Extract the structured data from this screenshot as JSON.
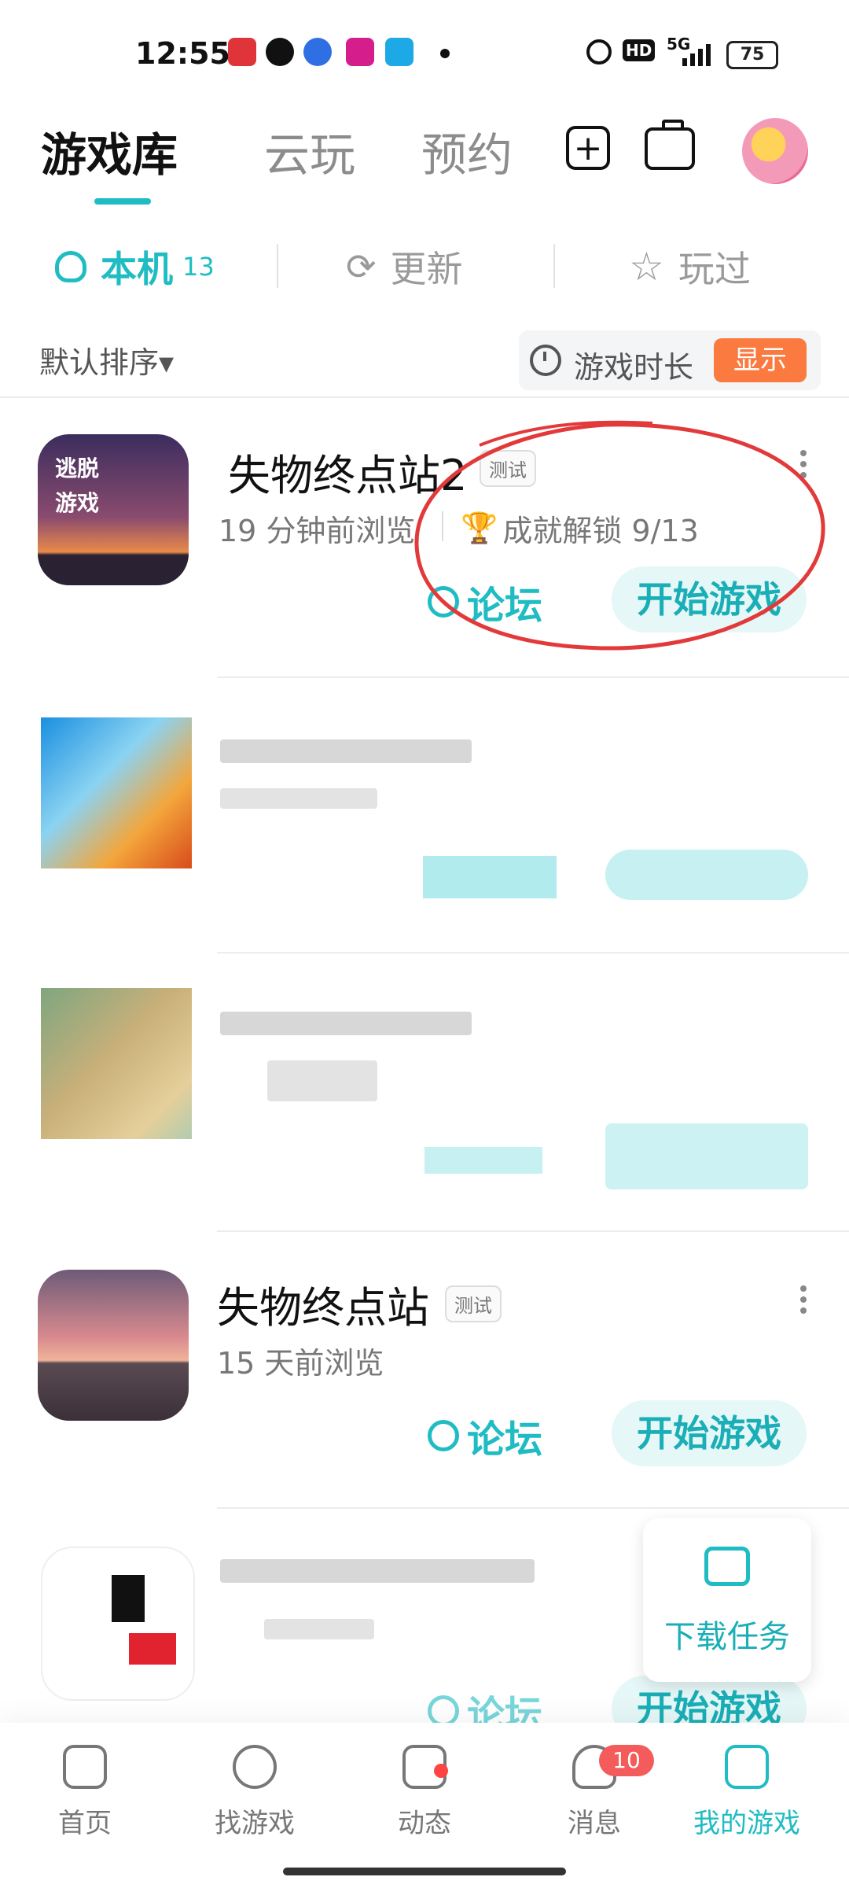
{
  "status_bar": {
    "time": "12:55",
    "battery": "75",
    "network": "5G",
    "hd": "HD"
  },
  "top_tabs": [
    "游戏库",
    "云玩",
    "预约"
  ],
  "sub_tabs": [
    {
      "label": "本机",
      "count": "13"
    },
    {
      "label": "更新"
    },
    {
      "label": "玩过"
    }
  ],
  "sort": {
    "label": "默认排序▾"
  },
  "playtime": {
    "label": "游戏时长",
    "toggle": "显示"
  },
  "games": [
    {
      "title": "失物终点站2",
      "badge": "测试",
      "browsed": "19 分钟前浏览",
      "achievement": "成就解锁 9/13",
      "icon_text": "逃脱\n游戏",
      "forum": "论坛",
      "start": "开始游戏"
    },
    {
      "title": "失物终点站",
      "badge": "测试",
      "browsed": "15 天前浏览",
      "forum": "论坛",
      "start": "开始游戏"
    },
    {
      "forum": "论坛",
      "start": "开始游戏"
    }
  ],
  "download_task": {
    "label": "下载任务"
  },
  "bottom_nav": [
    {
      "label": "首页"
    },
    {
      "label": "找游戏"
    },
    {
      "label": "动态"
    },
    {
      "label": "消息",
      "badge": "10"
    },
    {
      "label": "我的游戏"
    }
  ],
  "colors": {
    "accent": "#20bcc4",
    "orange": "#fb7a3f",
    "red_annotation": "#e23a3a"
  }
}
